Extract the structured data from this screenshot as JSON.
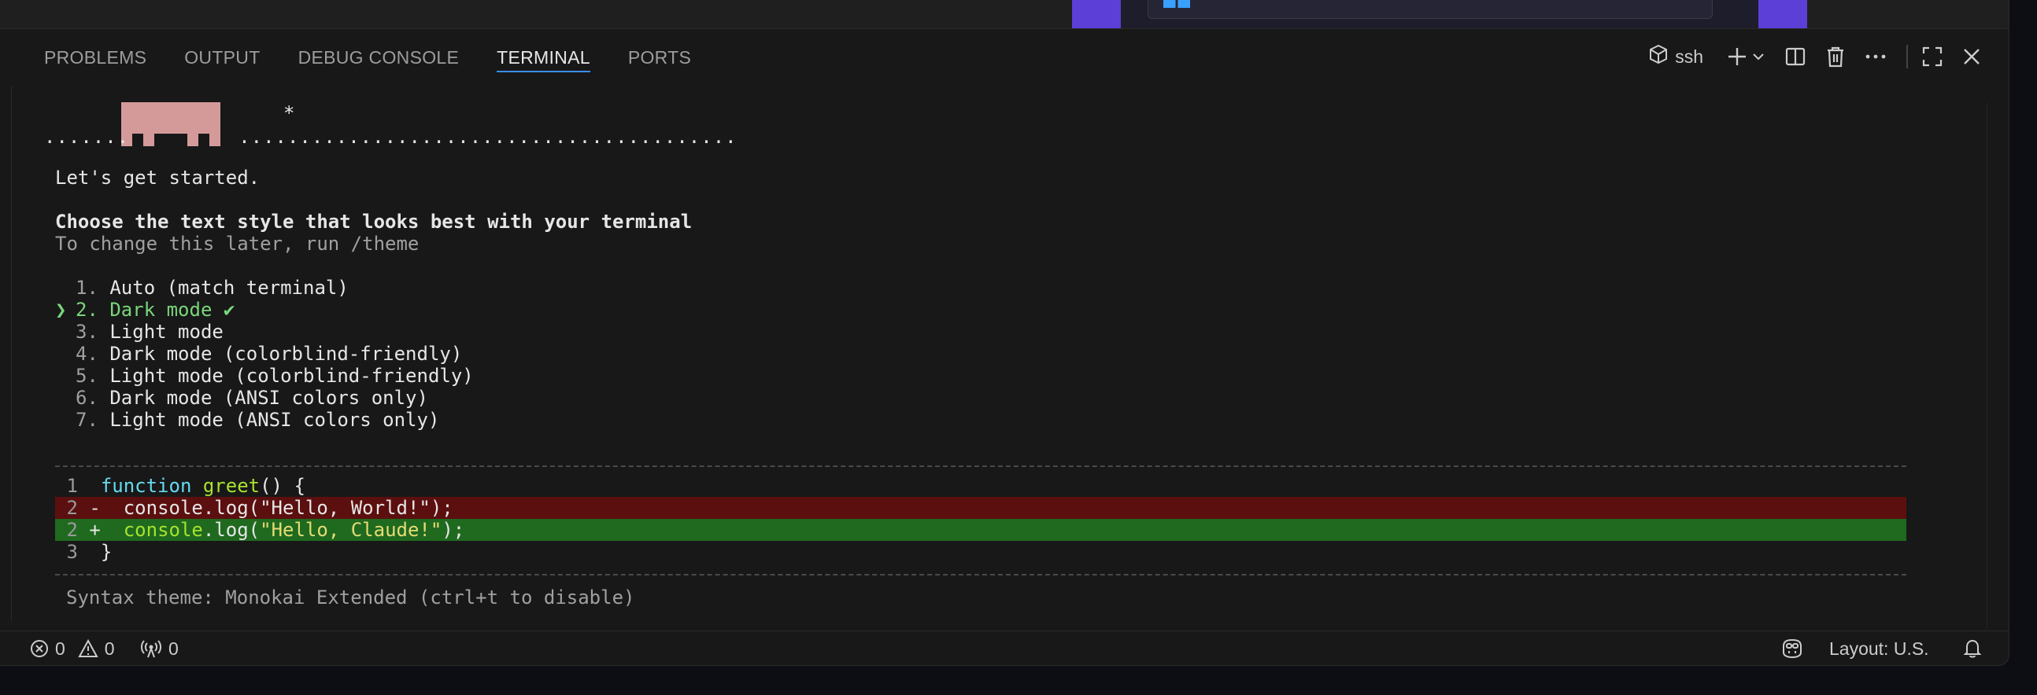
{
  "panel": {
    "tabs": [
      {
        "label": "PROBLEMS",
        "active": false
      },
      {
        "label": "OUTPUT",
        "active": false
      },
      {
        "label": "DEBUG CONSOLE",
        "active": false
      },
      {
        "label": "TERMINAL",
        "active": true
      },
      {
        "label": "PORTS",
        "active": false
      }
    ],
    "terminal_profile": "ssh"
  },
  "terminal": {
    "banner_dots": ".......         .........................................",
    "star": "*",
    "intro": "Let's get started.",
    "heading": "Choose the text style that looks best with your terminal",
    "hint": "To change this later, run /theme",
    "cursor": "❯",
    "options": [
      {
        "num": "1.",
        "label": "Auto (match terminal)",
        "selected": false
      },
      {
        "num": "2.",
        "label": "Dark mode ✔",
        "selected": true
      },
      {
        "num": "3.",
        "label": "Light mode",
        "selected": false
      },
      {
        "num": "4.",
        "label": "Dark mode (colorblind-friendly)",
        "selected": false
      },
      {
        "num": "5.",
        "label": "Light mode (colorblind-friendly)",
        "selected": false
      },
      {
        "num": "6.",
        "label": "Dark mode (ANSI colors only)",
        "selected": false
      },
      {
        "num": "7.",
        "label": "Light mode (ANSI colors only)",
        "selected": false
      }
    ],
    "code": {
      "l1_num": "1",
      "l1_kw": "function",
      "l1_fn": "greet",
      "l1_rest": "() {",
      "l2d_num": "2",
      "l2d_sign": "-",
      "l2d_code": "console.log(\"Hello, World!\");",
      "l2a_num": "2",
      "l2a_sign": "+",
      "l2a_obj": "console",
      "l2a_mid": ".log(",
      "l2a_str": "\"Hello, Claude!\"",
      "l2a_end": ");",
      "l3_num": "3",
      "l3_code": "}"
    },
    "syntax_note": "Syntax theme: Monokai Extended (ctrl+t to disable)"
  },
  "statusbar": {
    "errors": "0",
    "warnings": "0",
    "ports": "0",
    "layout": "Layout: U.S."
  },
  "colors": {
    "accent": "#3b8eea",
    "banner": "#d49a9a",
    "selected_option": "#7ad67a",
    "diff_removed": "#5c0f0f",
    "diff_added": "#1f6a1f"
  }
}
